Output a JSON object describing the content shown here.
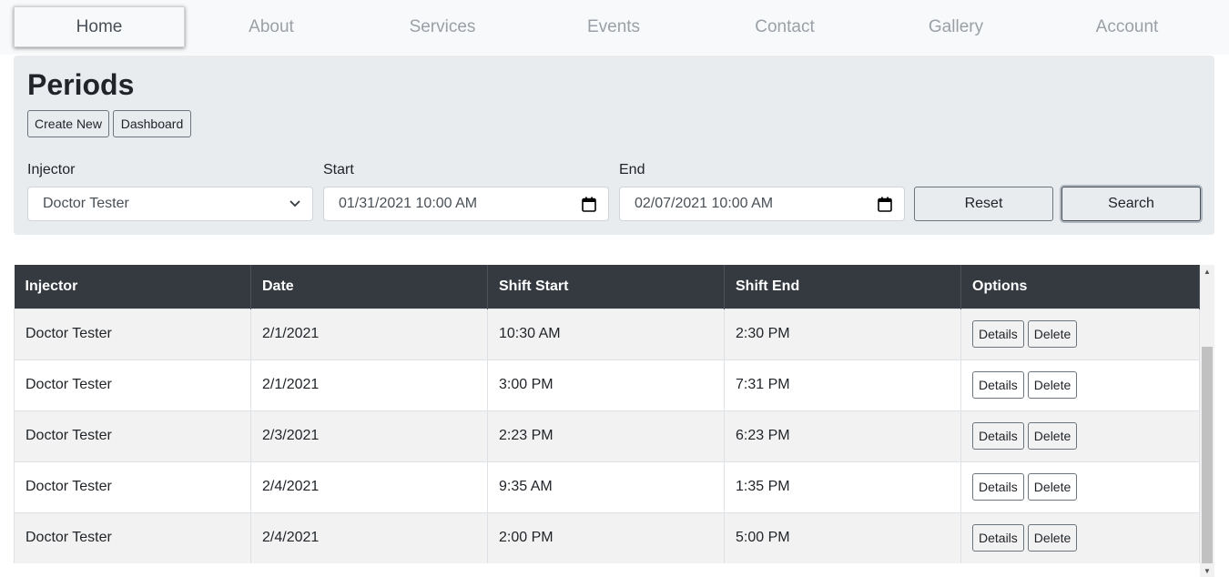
{
  "nav": {
    "items": [
      "Home",
      "About",
      "Services",
      "Events",
      "Contact",
      "Gallery",
      "Account"
    ],
    "active": "Home"
  },
  "panel": {
    "title": "Periods",
    "create_label": "Create New",
    "dashboard_label": "Dashboard",
    "injector_label": "Injector",
    "injector_value": "Doctor Tester",
    "start_label": "Start",
    "start_value": "01/31/2021 10:00 AM",
    "end_label": "End",
    "end_value": "02/07/2021 10:00 AM",
    "reset_label": "Reset",
    "search_label": "Search"
  },
  "table": {
    "headers": [
      "Injector",
      "Date",
      "Shift Start",
      "Shift End",
      "Options"
    ],
    "rows": [
      [
        "Doctor Tester",
        "2/1/2021",
        "10:30 AM",
        "2:30 PM"
      ],
      [
        "Doctor Tester",
        "2/1/2021",
        "3:00 PM",
        "7:31 PM"
      ],
      [
        "Doctor Tester",
        "2/3/2021",
        "2:23 PM",
        "6:23 PM"
      ],
      [
        "Doctor Tester",
        "2/4/2021",
        "9:35 AM",
        "1:35 PM"
      ],
      [
        "Doctor Tester",
        "2/4/2021",
        "2:00 PM",
        "5:00 PM"
      ]
    ],
    "details_label": "Details",
    "delete_label": "Delete"
  },
  "icons": {
    "calendar": "calendar-icon",
    "dropdown": "chevron-down-icon",
    "scroll_up": "scroll-up-arrow-icon",
    "scroll_down": "scroll-down-arrow-icon"
  },
  "colors": {
    "table_header": "#343a40",
    "panel_bg": "#e9ecef",
    "nav_bg": "#f8f9fa"
  }
}
